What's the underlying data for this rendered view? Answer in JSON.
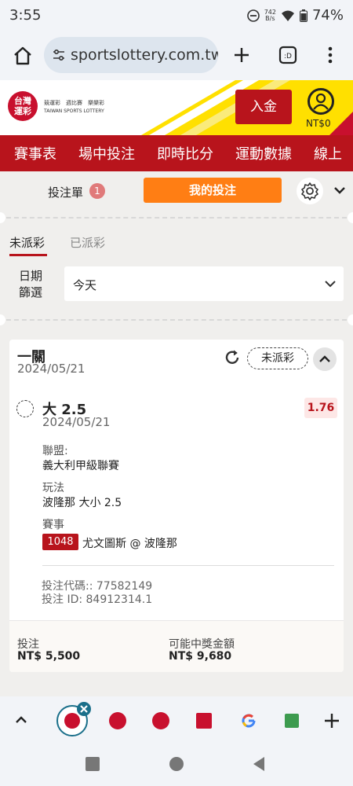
{
  "status_bar": {
    "time": "3:55",
    "speed_top": "742",
    "speed_bottom": "B/s",
    "battery": "74%"
  },
  "browser": {
    "url": "sportslottery.com.tw"
  },
  "site": {
    "logo_text": "台灣\n運彩",
    "logo_line1": "競運彩　週比賽　樂樂彩",
    "logo_line2": "TAIWAN SPORTS LOTTERY",
    "deposit_label": "入金",
    "balance": "NT$0"
  },
  "nav": {
    "items": [
      "賽事表",
      "場中投注",
      "即時比分",
      "運動數據",
      "線上"
    ]
  },
  "betslip_bar": {
    "slip_label": "投注單",
    "slip_count": "1",
    "my_bets_label": "我的投注"
  },
  "tabs": {
    "unsettled": "未派彩",
    "settled": "已派彩"
  },
  "filter": {
    "label_line1": "日期",
    "label_line2": "篩選",
    "selected": "今天"
  },
  "card": {
    "bet_type": "一關",
    "date": "2024/05/21",
    "status": "未派彩",
    "selection": "大 2.5",
    "selection_date": "2024/05/21",
    "odds": "1.76",
    "league_label": "聯盟:",
    "league_value": "義大利甲級聯賽",
    "market_label": "玩法",
    "market_value": "波隆那 大小 2.5",
    "event_label": "賽事",
    "match_no": "1048",
    "match_name": "尤文圖斯 @ 波隆那",
    "code_line": "投注代碼:: 77582149",
    "id_line": "投注 ID: 84912314.1",
    "stake_label": "投注",
    "stake_value": "NT$ 5,500",
    "payout_label": "可能中獎金額",
    "payout_value": "NT$ 9,680"
  },
  "colors": {
    "brand_red": "#b8141c",
    "orange": "#ff7e14",
    "yellow": "#ffe000"
  }
}
